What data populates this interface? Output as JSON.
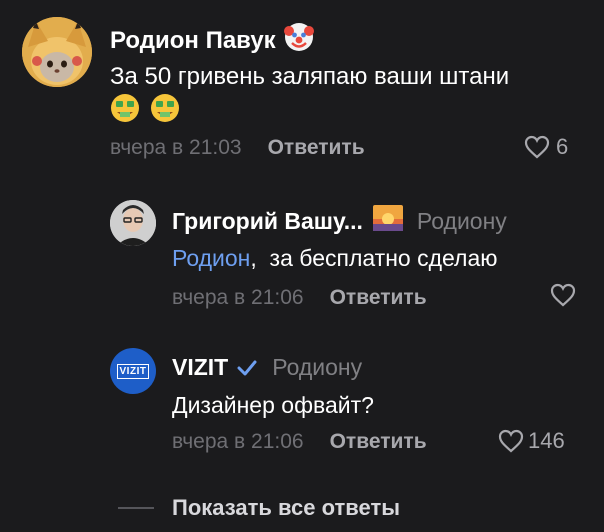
{
  "comments": [
    {
      "author": "Родион Павук",
      "badge_icon": "clown-face-icon",
      "text_line1": "За 50 гривень заляпаю ваши штани",
      "emojis": [
        "money-mouth-face-icon",
        "money-mouth-face-icon"
      ],
      "time": "вчера в 21:03",
      "reply_label": "Ответить",
      "likes": "6"
    },
    {
      "author": "Григорий Вашу...",
      "badge_icon": "sunset-image-icon",
      "reply_to": "Родиону",
      "mention": "Родион",
      "text": ",  за бесплатно сделаю",
      "time": "вчера в 21:06",
      "reply_label": "Ответить",
      "likes": ""
    },
    {
      "author": "VIZIT",
      "avatar_text": "VIZIT",
      "verified_icon": "checkmark-icon",
      "reply_to": "Родиону",
      "text": "Дизайнер офвайт?",
      "time": "вчера в 21:06",
      "reply_label": "Ответить",
      "likes": "146"
    }
  ],
  "show_all_replies": "Показать все ответы",
  "colors": {
    "background": "#1b1b1d",
    "accent_blue": "#6e9ff0",
    "muted": "#808084",
    "vizit_blue": "#1e5ec8"
  }
}
